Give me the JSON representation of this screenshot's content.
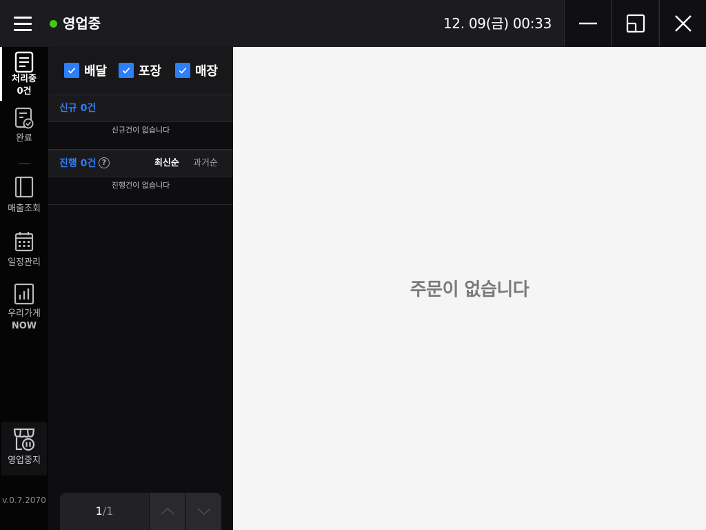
{
  "titlebar": {
    "status": "영업중",
    "status_color": "#43c918",
    "datetime": "12. 09(금) 00:33",
    "icons": [
      "menu-icon",
      "minimize-icon",
      "restore-icon",
      "close-icon"
    ]
  },
  "nav": {
    "items": [
      {
        "label": "처리중",
        "sub": "0건",
        "icon": "order-list-icon",
        "active": true
      },
      {
        "label": "완료",
        "icon": "order-complete-icon"
      },
      {
        "label": "매출조회",
        "icon": "sales-book-icon"
      },
      {
        "label": "일정관리",
        "icon": "calendar-icon"
      },
      {
        "label": "우리가게",
        "sub": "NOW",
        "icon": "bar-chart-icon"
      }
    ],
    "stop": {
      "label": "영업중지",
      "icon": "store-pause-icon"
    },
    "version": "v.0.7.2070"
  },
  "filters": [
    {
      "label": "배달",
      "checked": true
    },
    {
      "label": "포장",
      "checked": true
    },
    {
      "label": "매장",
      "checked": true
    }
  ],
  "sections": {
    "new": {
      "title": "신규 0건",
      "empty": "신규건이 없습니다"
    },
    "progress": {
      "title": "진행 0건",
      "empty": "진행건이 없습니다",
      "sort_latest": "최신순",
      "sort_oldest": "과거순"
    }
  },
  "pager": {
    "current": "1",
    "separator": "/",
    "total": "1"
  },
  "main": {
    "empty": "주문이 없습니다"
  },
  "colors": {
    "accent": "#2d7ef7"
  }
}
